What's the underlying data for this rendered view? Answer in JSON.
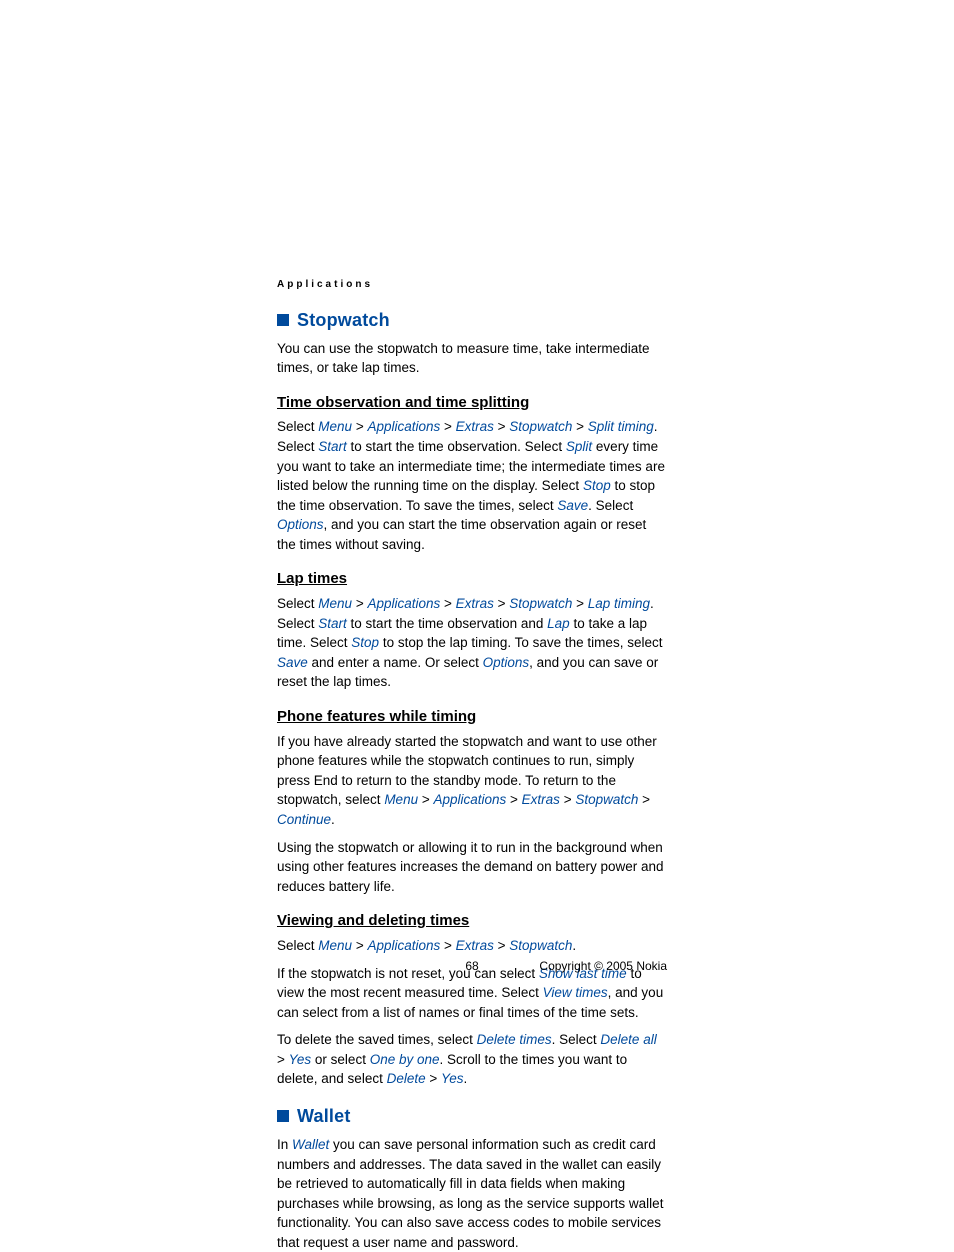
{
  "header": {
    "title": "Applications"
  },
  "sections": {
    "stopwatch": {
      "title": "Stopwatch",
      "intro": "You can use the stopwatch to measure time, take intermediate times, or take lap times.",
      "timeObservation": {
        "heading": "Time observation and time splitting",
        "p1a": "Select ",
        "menu": "Menu",
        "gt": " > ",
        "applications": "Applications",
        "extras": "Extras",
        "stopwatch": "Stopwatch",
        "splitTiming": "Split timing",
        "p1b": ". Select ",
        "start": "Start",
        "p1c": " to start the time observation. Select ",
        "split": "Split",
        "p1d": " every time you want to take an intermediate time; the intermediate times are listed below the running time on the display. Select ",
        "stop": "Stop",
        "p1e": " to stop the time observation. To save the times, select ",
        "save": "Save",
        "p1f": ". Select ",
        "options": "Options",
        "p1g": ", and you can start the time observation again or reset the times without saving."
      },
      "lapTimes": {
        "heading": "Lap times",
        "p1a": "Select ",
        "menu": "Menu",
        "applications": "Applications",
        "extras": "Extras",
        "stopwatch": "Stopwatch",
        "lapTiming": "Lap timing",
        "p1b": ". Select ",
        "start": "Start",
        "p1c": " to start the time observation and ",
        "lap": "Lap",
        "p1d": " to take a lap time. Select ",
        "stop": "Stop",
        "p1e": " to stop the lap timing. To save the times, select ",
        "save": "Save",
        "p1f": " and enter a name. Or select ",
        "options": "Options",
        "p1g": ", and you can save or reset the lap times."
      },
      "phoneFeatures": {
        "heading": "Phone features while timing",
        "p1a": "If you have already started the stopwatch and want to use other phone features while the stopwatch continues to run, simply press End to return to the standby mode. To return to the stopwatch, select ",
        "menu": "Menu",
        "applications": "Applications",
        "extras": "Extras",
        "stopwatch": "Stopwatch",
        "continue": "Continue",
        "p1b": ".",
        "p2": "Using the stopwatch or allowing it to run in the background when using other features increases the demand on battery power and reduces battery life."
      },
      "viewingDeleting": {
        "heading": "Viewing and deleting times",
        "p1a": "Select ",
        "menu": "Menu",
        "applications": "Applications",
        "extras": "Extras",
        "stopwatch": "Stopwatch",
        "p1b": ".",
        "p2a": "If the stopwatch is not reset, you can select ",
        "showLast": "Show last time",
        "p2b": " to view the most recent measured time. Select ",
        "viewTimes": "View times",
        "p2c": ", and you can select from a list of names or final times of the time sets.",
        "p3a": "To delete the saved times, select ",
        "deleteTimes": "Delete times",
        "p3b": ". Select ",
        "deleteAll": "Delete all",
        "yes": "Yes",
        "p3c": " or select ",
        "oneByOne": "One by one",
        "p3d": ". Scroll to the times you want to delete, and select ",
        "delete": "Delete",
        "p3e": "."
      }
    },
    "wallet": {
      "title": "Wallet",
      "p1a": "In ",
      "walletTerm": "Wallet",
      "p1b": " you can save personal information such as credit card numbers and addresses. The data saved in the wallet can easily be retrieved to automatically fill in data fields when making purchases while browsing, as long as the service supports wallet functionality. You can also save access codes to mobile services that request a user name and password."
    }
  },
  "footer": {
    "pageNumber": "68",
    "copyright": "Copyright © 2005 Nokia"
  }
}
